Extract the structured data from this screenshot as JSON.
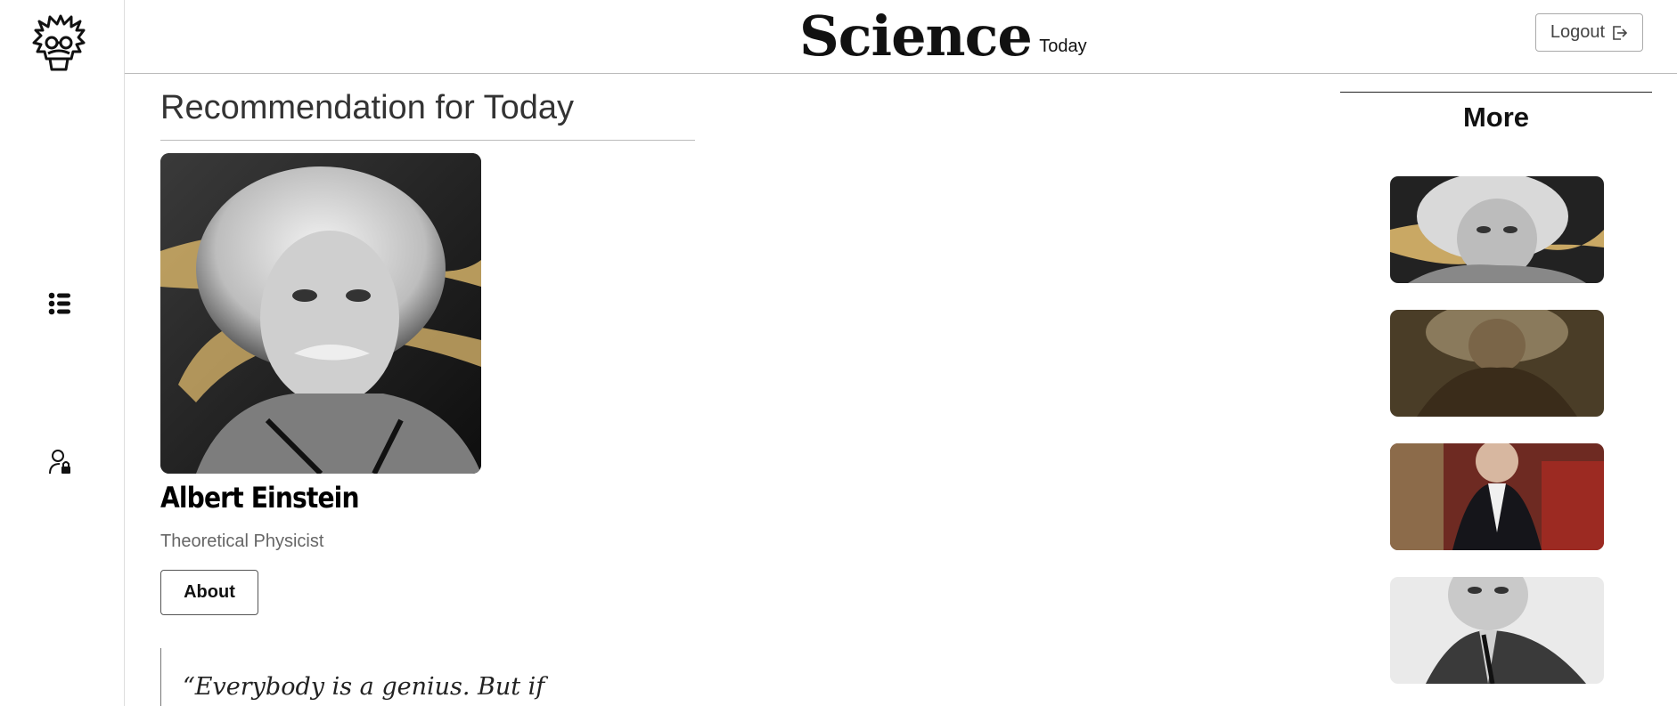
{
  "header": {
    "brand_main": "Science",
    "brand_sub": "Today",
    "logout_label": "Logout"
  },
  "sidebar": {
    "logo_icon": "einstein-face-icon",
    "items": [
      {
        "icon": "list-icon"
      },
      {
        "icon": "user-lock-icon"
      }
    ]
  },
  "main": {
    "section_title": "Recommendation for Today",
    "person": {
      "name": "Albert Einstein",
      "role": "Theoretical Physicist",
      "about_label": "About",
      "quote": "“Everybody is a genius. But if"
    }
  },
  "more": {
    "title": "More",
    "thumbnails": [
      {
        "image": "einstein-portrait"
      },
      {
        "image": "long-haired-man-painting"
      },
      {
        "image": "seated-man-painting"
      },
      {
        "image": "black-and-white-man-photo"
      }
    ]
  },
  "colors": {
    "accent_gold": "#C9A864",
    "border": "#BBBBBB",
    "text_dark": "#111111"
  }
}
